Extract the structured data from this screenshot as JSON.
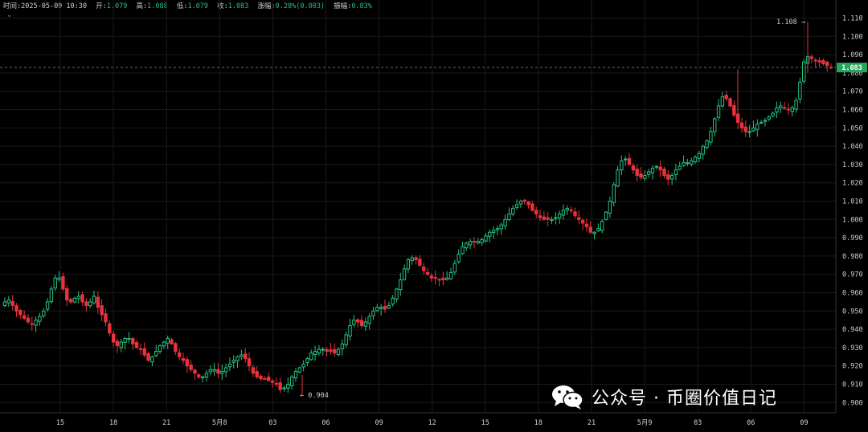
{
  "info": {
    "time_label": "时间:",
    "time": "2025-05-09 10:30",
    "open_label": "开:",
    "open": "1.079",
    "high_label": "高:",
    "high": "1.088",
    "low_label": "低:",
    "low": "1.079",
    "close_label": "收:",
    "close": "1.083",
    "change_label": "涨幅:",
    "change": "0.28%(0.003)",
    "amplitude_label": "振幅:",
    "amplitude": "0.83%"
  },
  "watermark": {
    "icon": "wechat-icon",
    "text": "公众号 · 币圈价值日记"
  },
  "colors": {
    "up": "#26c281",
    "down": "#e8323c",
    "grid": "#1b1b1b",
    "price_tag": "#26a65b",
    "current_line": "#6a6a6a"
  },
  "chart_data": {
    "type": "candlestick",
    "ylim": [
      0.894,
      1.116
    ],
    "y_ticks": [
      "0.900",
      "0.910",
      "0.920",
      "0.930",
      "0.940",
      "0.950",
      "0.960",
      "0.970",
      "0.980",
      "0.990",
      "1.000",
      "1.010",
      "1.020",
      "1.030",
      "1.040",
      "1.050",
      "1.060",
      "1.070",
      "1.080",
      "1.090",
      "1.100",
      "1.110"
    ],
    "x_ticks": [
      "15",
      "18",
      "21",
      "5月8",
      "03",
      "06",
      "09",
      "12",
      "15",
      "18",
      "21",
      "5月9",
      "03",
      "06",
      "09"
    ],
    "current_price": "1.083",
    "annotations": [
      {
        "text": "1.108 →",
        "value": 1.108
      },
      {
        "text": "← 0.904",
        "value": 0.904
      }
    ],
    "close_path": [
      0.955,
      0.956,
      0.953,
      0.95,
      0.948,
      0.946,
      0.944,
      0.943,
      0.945,
      0.947,
      0.95,
      0.955,
      0.962,
      0.968,
      0.968,
      0.962,
      0.956,
      0.955,
      0.957,
      0.958,
      0.955,
      0.953,
      0.955,
      0.958,
      0.952,
      0.948,
      0.944,
      0.938,
      0.933,
      0.931,
      0.933,
      0.935,
      0.935,
      0.932,
      0.93,
      0.929,
      0.926,
      0.923,
      0.925,
      0.928,
      0.931,
      0.933,
      0.935,
      0.932,
      0.928,
      0.925,
      0.923,
      0.92,
      0.918,
      0.916,
      0.914,
      0.914,
      0.916,
      0.918,
      0.918,
      0.916,
      0.917,
      0.919,
      0.921,
      0.923,
      0.925,
      0.926,
      0.924,
      0.92,
      0.916,
      0.914,
      0.913,
      0.913,
      0.912,
      0.911,
      0.91,
      0.907,
      0.908,
      0.91,
      0.914,
      0.917,
      0.919,
      0.921,
      0.924,
      0.927,
      0.928,
      0.929,
      0.929,
      0.928,
      0.928,
      0.927,
      0.929,
      0.932,
      0.937,
      0.942,
      0.945,
      0.944,
      0.942,
      0.944,
      0.947,
      0.95,
      0.952,
      0.952,
      0.951,
      0.953,
      0.957,
      0.962,
      0.967,
      0.973,
      0.978,
      0.979,
      0.978,
      0.975,
      0.972,
      0.97,
      0.968,
      0.968,
      0.967,
      0.967,
      0.968,
      0.971,
      0.976,
      0.981,
      0.985,
      0.987,
      0.988,
      0.988,
      0.988,
      0.989,
      0.991,
      0.993,
      0.994,
      0.995,
      0.997,
      1.0,
      1.003,
      1.006,
      1.008,
      1.01,
      1.01,
      1.008,
      1.005,
      1.003,
      1.001,
      1.0,
      1.0,
      1.0,
      1.001,
      1.003,
      1.005,
      1.006,
      1.005,
      1.002,
      1.0,
      0.998,
      0.996,
      0.993,
      0.993,
      0.995,
      0.999,
      1.004,
      1.01,
      1.019,
      1.027,
      1.032,
      1.033,
      1.03,
      1.027,
      1.024,
      1.023,
      1.024,
      1.026,
      1.028,
      1.029,
      1.027,
      1.024,
      1.022,
      1.024,
      1.027,
      1.029,
      1.031,
      1.031,
      1.032,
      1.034,
      1.036,
      1.04,
      1.043,
      1.048,
      1.055,
      1.062,
      1.067,
      1.066,
      1.062,
      1.057,
      1.053,
      1.05,
      1.048,
      1.048,
      1.05,
      1.052,
      1.053,
      1.054,
      1.056,
      1.058,
      1.061,
      1.062,
      1.061,
      1.06,
      1.061,
      1.065,
      1.075,
      1.086,
      1.089,
      1.088,
      1.087,
      1.086,
      1.085,
      1.084,
      1.083
    ]
  }
}
